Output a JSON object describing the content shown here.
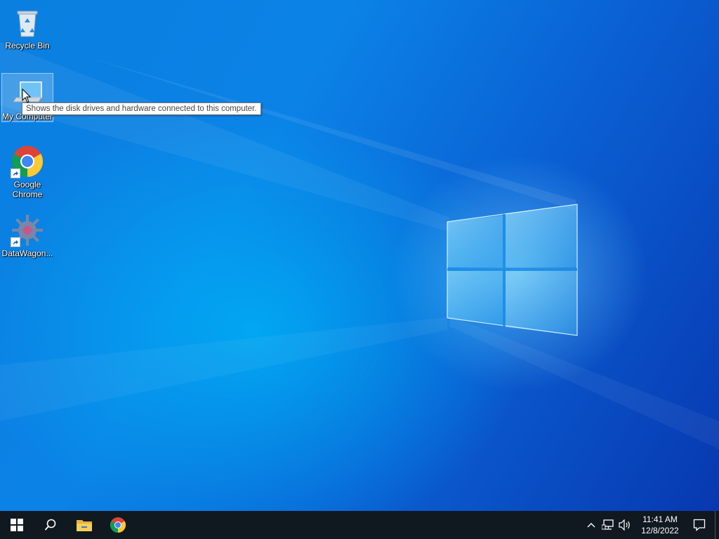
{
  "desktop": {
    "icons": [
      {
        "label": "Recycle Bin",
        "icon": "recycle-bin-icon"
      },
      {
        "label": "My Computer",
        "icon": "computer-icon"
      },
      {
        "label": "Google Chrome",
        "icon": "chrome-icon"
      },
      {
        "label": "DataWagon...",
        "icon": "datawagon-icon"
      }
    ],
    "tooltip": "Shows the disk drives and hardware connected to this computer."
  },
  "taskbar": {
    "start": "windows-start-icon",
    "search": "search-icon",
    "pinned": [
      "file-explorer-icon",
      "chrome-icon"
    ],
    "tray": {
      "icons": [
        "chevron-up-icon",
        "network-icon",
        "volume-icon"
      ],
      "time": "11:41 AM",
      "date": "12/8/2022",
      "notifications": "action-center-icon"
    }
  },
  "colors": {
    "accent": "#0a78dc",
    "taskbar": "#101820"
  }
}
